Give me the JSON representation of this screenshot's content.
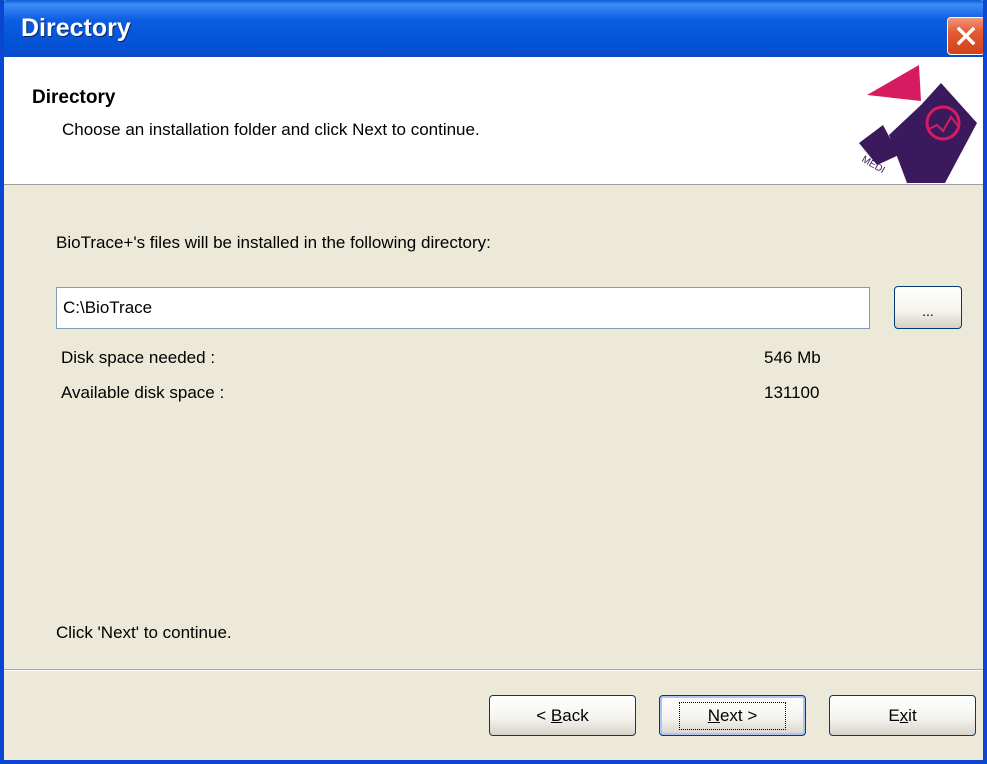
{
  "window": {
    "title": "Directory",
    "close_icon": "close-icon"
  },
  "header": {
    "title": "Directory",
    "subtitle": "Choose an installation folder and click Next to continue.",
    "logo_letters": "MEDI",
    "logo_colors": [
      "#d81b60",
      "#3a1a5c"
    ]
  },
  "main": {
    "intro": "BioTrace+'s files will be installed in the following directory:",
    "path_value": "C:\\BioTrace",
    "browse_label": "...",
    "disk_needed_label": "Disk space needed :",
    "disk_needed_value": "546 Mb",
    "disk_available_label": "Available disk space :",
    "disk_available_value": "131100",
    "footer_hint": "Click 'Next' to continue."
  },
  "buttons": {
    "back": {
      "prefix": "< ",
      "mnemonic": "B",
      "rest": "ack"
    },
    "next": {
      "mnemonic": "N",
      "rest": "ext >"
    },
    "exit": {
      "prefix": "E",
      "mnemonic": "x",
      "rest": "it"
    }
  },
  "colors": {
    "titlebar": "#0553d6",
    "face": "#ece9d8",
    "close": "#e35a33"
  }
}
